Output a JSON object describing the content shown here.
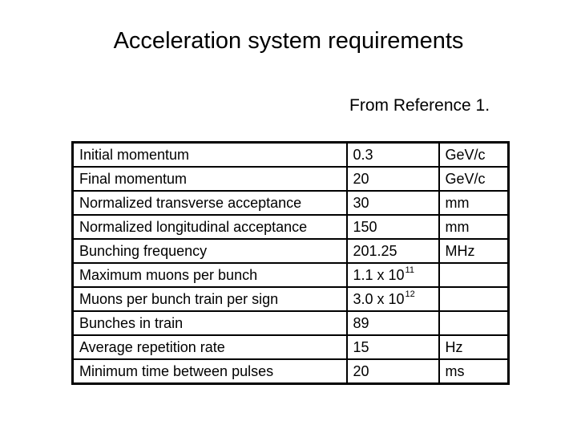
{
  "title": "Acceleration system requirements",
  "reference": "From Reference 1.",
  "table": {
    "rows": [
      {
        "parameter": "Initial momentum",
        "value": "0.3",
        "exponent": null,
        "unit": "GeV/c"
      },
      {
        "parameter": "Final momentum",
        "value": "20",
        "exponent": null,
        "unit": "GeV/c"
      },
      {
        "parameter": "Normalized transverse acceptance",
        "value": "30",
        "exponent": null,
        "unit": "mm"
      },
      {
        "parameter": "Normalized longitudinal acceptance",
        "value": "150",
        "exponent": null,
        "unit": "mm"
      },
      {
        "parameter": "Bunching frequency",
        "value": "201.25",
        "exponent": null,
        "unit": "MHz"
      },
      {
        "parameter": "Maximum muons per bunch",
        "value": "1.1 x 10",
        "exponent": "11",
        "unit": ""
      },
      {
        "parameter": "Muons per bunch train per sign",
        "value": "3.0 x 10",
        "exponent": "12",
        "unit": ""
      },
      {
        "parameter": "Bunches in train",
        "value": "89",
        "exponent": null,
        "unit": ""
      },
      {
        "parameter": "Average repetition rate",
        "value": "15",
        "exponent": null,
        "unit": "Hz"
      },
      {
        "parameter": "Minimum time between pulses",
        "value": "20",
        "exponent": null,
        "unit": "ms"
      }
    ]
  }
}
